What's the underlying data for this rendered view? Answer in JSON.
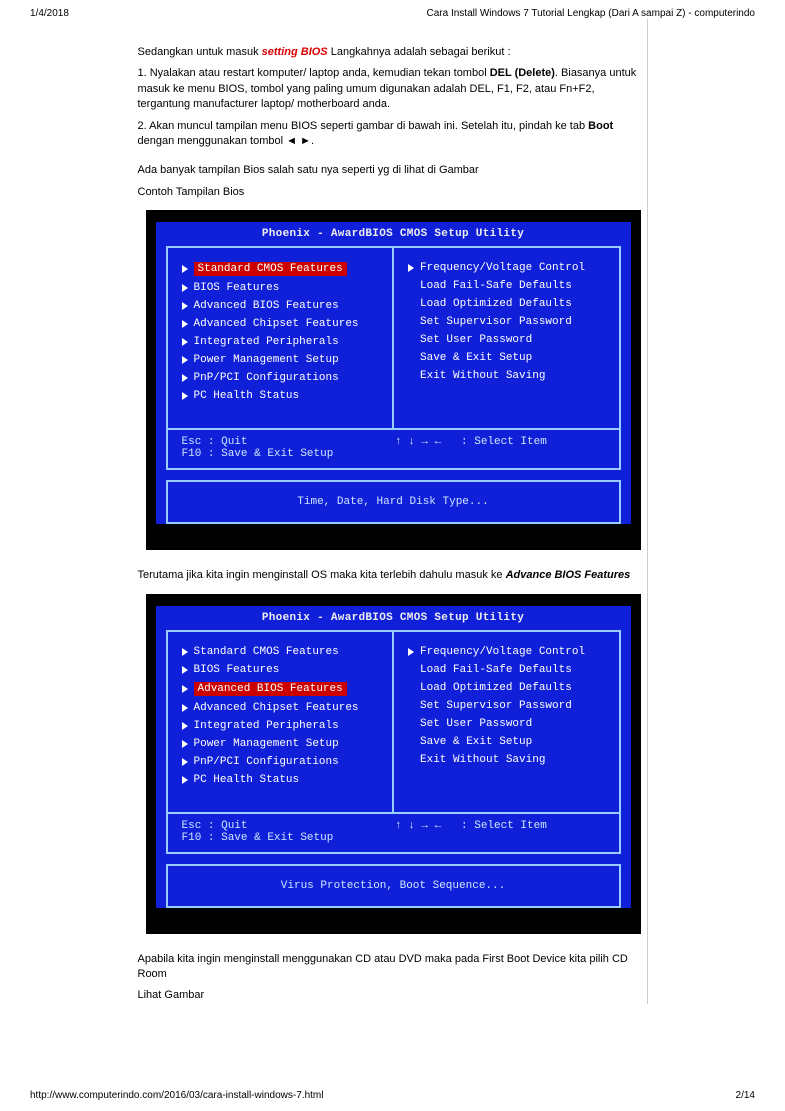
{
  "header": {
    "date": "1/4/2018",
    "title": "Cara Install Windows 7 Tutorial Lengkap (Dari A sampai Z) - computerindo"
  },
  "article": {
    "intro_prefix": "Sedangkan untuk masuk ",
    "intro_bold": "setting BIOS",
    "intro_suffix": " Langkahnya adalah sebagai berikut  :",
    "step1_a": "1. Nyalakan atau restart komputer/ laptop anda, kemudian tekan tombol ",
    "step1_bold": "DEL (Delete)",
    "step1_b": ". Biasanya untuk masuk ke menu BIOS, tombol yang paling umum digunakan adalah DEL, F1, F2, atau Fn+F2, tergantung manufacturer laptop/ motherboard anda.",
    "step2_a": "2. Akan muncul tampilan menu BIOS seperti gambar di bawah ini. Setelah itu, pindah ke tab ",
    "step2_bold": "Boot",
    "step2_b": " dengan menggunakan tombol ◄ ►.",
    "note1": "Ada banyak tampilan Bios salah satu nya seperti yg di lihat di Gambar",
    "note2": "Contoh Tampilan Bios",
    "mid_a": "Terutama jika kita ingin menginstall OS maka kita terlebih dahulu masuk ke ",
    "mid_bold": "Advance BIOS Features",
    "after_a": "Apabila kita ingin menginstall menggunakan CD atau DVD maka pada First Boot Device kita pilih CD Room",
    "after_b": "Lihat Gambar"
  },
  "bios1": {
    "title": "Phoenix - AwardBIOS CMOS Setup Utility",
    "left": [
      {
        "tri": true,
        "sel": true,
        "label": "Standard CMOS Features"
      },
      {
        "tri": true,
        "sel": false,
        "label": "BIOS Features"
      },
      {
        "tri": true,
        "sel": false,
        "label": "Advanced BIOS Features"
      },
      {
        "tri": true,
        "sel": false,
        "label": "Advanced Chipset Features"
      },
      {
        "tri": true,
        "sel": false,
        "label": "Integrated Peripherals"
      },
      {
        "tri": true,
        "sel": false,
        "label": "Power Management Setup"
      },
      {
        "tri": true,
        "sel": false,
        "label": "PnP/PCI Configurations"
      },
      {
        "tri": true,
        "sel": false,
        "label": "PC Health Status"
      }
    ],
    "right": [
      {
        "tri": true,
        "sel": false,
        "label": "Frequency/Voltage Control"
      },
      {
        "tri": false,
        "sel": false,
        "label": "Load Fail-Safe Defaults"
      },
      {
        "tri": false,
        "sel": false,
        "label": "Load Optimized Defaults"
      },
      {
        "tri": false,
        "sel": false,
        "label": "Set Supervisor Password"
      },
      {
        "tri": false,
        "sel": false,
        "label": "Set User Password"
      },
      {
        "tri": false,
        "sel": false,
        "label": "Save & Exit Setup"
      },
      {
        "tri": false,
        "sel": false,
        "label": "Exit Without Saving"
      }
    ],
    "hint_left": "Esc : Quit\nF10 : Save & Exit Setup",
    "hint_right": "↑ ↓ → ←   : Select Item",
    "help": "Time, Date, Hard Disk Type..."
  },
  "bios2": {
    "title": "Phoenix - AwardBIOS CMOS Setup Utility",
    "left": [
      {
        "tri": true,
        "sel": false,
        "label": "Standard CMOS Features"
      },
      {
        "tri": true,
        "sel": false,
        "label": "BIOS Features"
      },
      {
        "tri": true,
        "sel": true,
        "label": "Advanced BIOS Features"
      },
      {
        "tri": true,
        "sel": false,
        "label": "Advanced Chipset Features"
      },
      {
        "tri": true,
        "sel": false,
        "label": "Integrated Peripherals"
      },
      {
        "tri": true,
        "sel": false,
        "label": "Power Management Setup"
      },
      {
        "tri": true,
        "sel": false,
        "label": "PnP/PCI Configurations"
      },
      {
        "tri": true,
        "sel": false,
        "label": "PC Health Status"
      }
    ],
    "right": [
      {
        "tri": true,
        "sel": false,
        "label": "Frequency/Voltage Control"
      },
      {
        "tri": false,
        "sel": false,
        "label": "Load Fail-Safe Defaults"
      },
      {
        "tri": false,
        "sel": false,
        "label": "Load Optimized Defaults"
      },
      {
        "tri": false,
        "sel": false,
        "label": "Set Supervisor Password"
      },
      {
        "tri": false,
        "sel": false,
        "label": "Set User Password"
      },
      {
        "tri": false,
        "sel": false,
        "label": "Save & Exit Setup"
      },
      {
        "tri": false,
        "sel": false,
        "label": "Exit Without Saving"
      }
    ],
    "hint_left": "Esc : Quit\nF10 : Save & Exit Setup",
    "hint_right": "↑ ↓ → ←   : Select Item",
    "help": "Virus Protection, Boot Sequence..."
  },
  "footer": {
    "url": "http://www.computerindo.com/2016/03/cara-install-windows-7.html",
    "page": "2/14"
  }
}
